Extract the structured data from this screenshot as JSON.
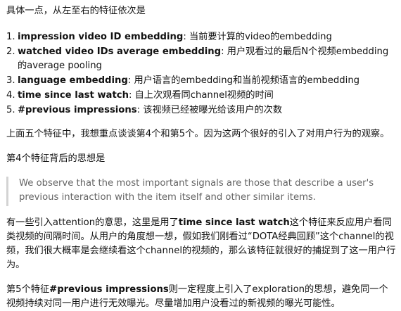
{
  "intro": "具体一点，从左至右的特征依次是",
  "features": [
    {
      "num": "1.",
      "term": "impression video ID embedding",
      "desc": ": 当前要计算的video的embedding"
    },
    {
      "num": "2.",
      "term": "watched video IDs average embedding",
      "desc": ": 用户观看过的最后N个视频embedding的average pooling"
    },
    {
      "num": "3.",
      "term": "language embedding",
      "desc": ": 用户语言的embedding和当前视频语言的embedding"
    },
    {
      "num": "4.",
      "term": "time since last watch",
      "desc": ": 自上次观看同channel视频的时间"
    },
    {
      "num": "5.",
      "term": "#previous impressions",
      "desc": ": 该视频已经被曝光给该用户的次数"
    }
  ],
  "para1": "上面五个特征中，我想重点谈谈第4个和第5个。因为这两个很好的引入了对用户行为的观察。",
  "para2": "第4个特征背后的思想是",
  "quote": "We observe that the most important signals are those that describe a user's previous interaction with the item itself and other similar items.",
  "para3": {
    "pre": "有一些引入attention的意思，这里是用了",
    "bold": "time since last watch",
    "post": "这个特征来反应用户看同类视频的间隔时间。从用户的角度想一想，假如我们刚看过“DOTA经典回顾”这个channel的视频，我们很大概率是会继续看这个channel的视频的，那么该特征就很好的捕捉到了这一用户行为。"
  },
  "para4": {
    "pre": "第5个特征",
    "bold": "#previous impressions",
    "post": "则一定程度上引入了exploration的思想，避免同一个视频持续对同一用户进行无效曝光。尽量增加用户没看过的新视频的曝光可能性。"
  }
}
